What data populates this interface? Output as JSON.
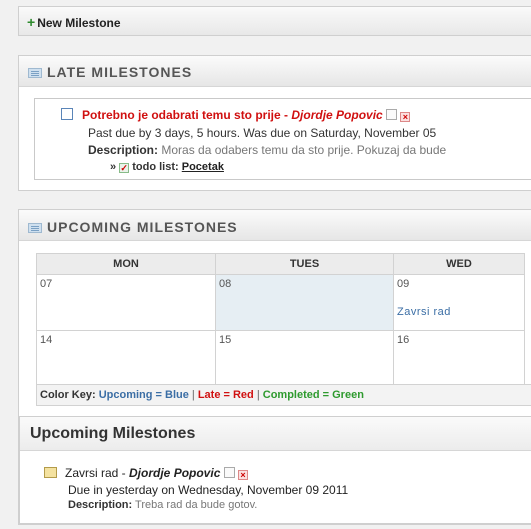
{
  "toolbar": {
    "new_milestone_label": "New Milestone",
    "plus_icon": "+"
  },
  "late": {
    "title": "LATE MILESTONES",
    "item": {
      "title": "Potrebno je odabrati temu sto prije",
      "separator": " - ",
      "owner": "Djordje Popovic",
      "due_text": "Past due by 3 days, 5 hours. Was due on Saturday, November 05",
      "description_label": "Description:",
      "description": "Moras da odabers temu da sto prije. Pokuzaj da bude",
      "todo_prefix": "»",
      "todo_label": "todo list:",
      "todo_link": "Pocetak"
    }
  },
  "upcoming": {
    "title": "UPCOMING MILESTONES",
    "calendar": {
      "headers": [
        "MON",
        "TUES",
        "WED"
      ],
      "rows": [
        [
          {
            "day": "07",
            "event": ""
          },
          {
            "day": "08",
            "event": ""
          },
          {
            "day": "09",
            "event": "Zavrsi rad"
          }
        ],
        [
          {
            "day": "14",
            "event": ""
          },
          {
            "day": "15",
            "event": ""
          },
          {
            "day": "16",
            "event": ""
          }
        ]
      ]
    },
    "color_key": {
      "label": "Color Key:",
      "upcoming": "Upcoming = Blue",
      "late": "Late = Red",
      "completed": "Completed = Green",
      "sep": "|"
    },
    "list_title": "Upcoming Milestones",
    "item": {
      "title": "Zavrsi rad",
      "separator": " - ",
      "owner": "Djordje Popovic",
      "due_text": "Due in yesterday on Wednesday, November 09 2011",
      "description_label": "Description:",
      "description": "Treba rad da bude gotov."
    }
  },
  "colors": {
    "late": "#d01010",
    "upcoming": "#3b6ea5",
    "completed": "#2e9a2e",
    "today_bg": "#e6eef3"
  }
}
